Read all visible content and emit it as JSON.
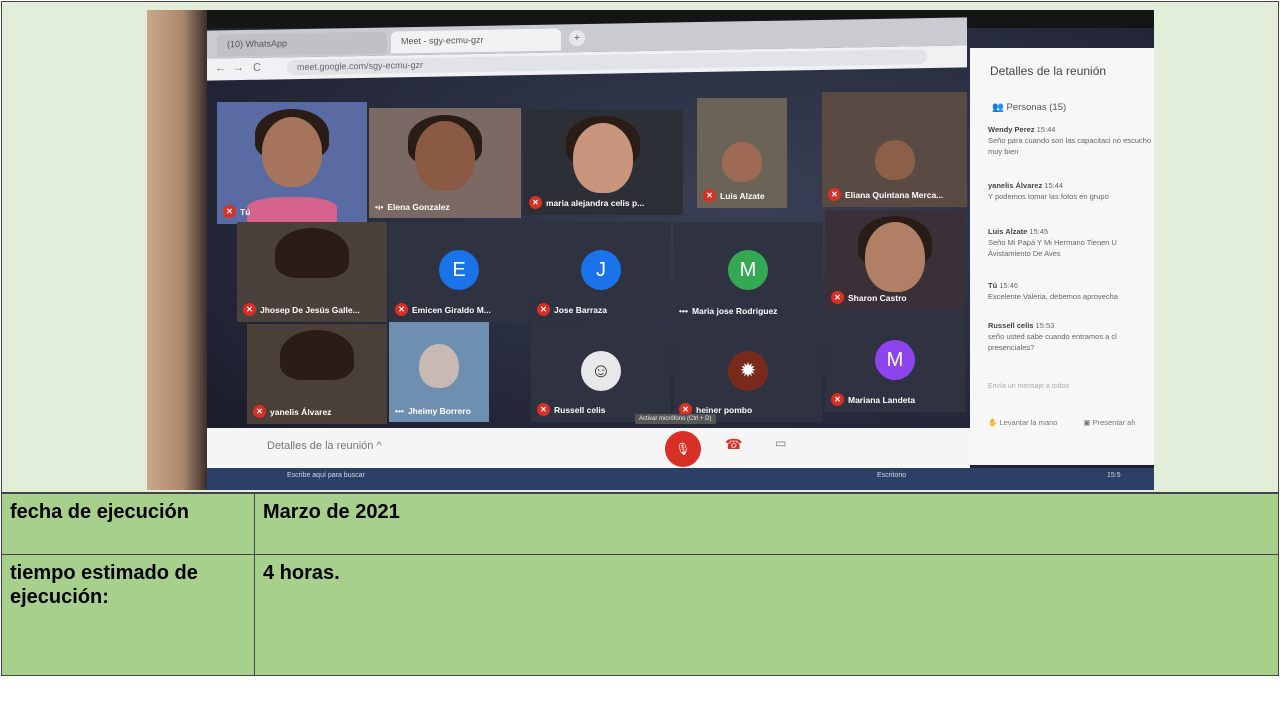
{
  "browser": {
    "tab1_label": "(10) WhatsApp",
    "tab2_label": "Meet - sgy-ecmu-gzr",
    "new_tab": "+",
    "url": "meet.google.com/sgy-ecmu-gzr"
  },
  "participants": [
    {
      "name": "Tú",
      "type": "video"
    },
    {
      "name": "Elena Gonzalez",
      "type": "video"
    },
    {
      "name": "maria alejandra celis p...",
      "type": "video"
    },
    {
      "name": "Luis Alzate",
      "type": "video"
    },
    {
      "name": "Eliana Quintana Merca...",
      "type": "video"
    },
    {
      "name": "Jhosep De Jesús Galle...",
      "type": "video"
    },
    {
      "name": "Emicen Giraldo M...",
      "type": "avatar",
      "initial": "E",
      "color": "#1a73e8"
    },
    {
      "name": "Jose Barraza",
      "type": "avatar",
      "initial": "J",
      "color": "#1a73e8"
    },
    {
      "name": "Maria jose Rodriguez",
      "type": "avatar",
      "initial": "M",
      "color": "#34a853"
    },
    {
      "name": "Sharon Castro",
      "type": "video"
    },
    {
      "name": "yanelis Álvarez",
      "type": "video"
    },
    {
      "name": "Jheimy Borrero",
      "type": "video"
    },
    {
      "name": "Russell celis",
      "type": "image"
    },
    {
      "name": "heiner pombo",
      "type": "image"
    },
    {
      "name": "Mariana Landeta",
      "type": "avatar",
      "initial": "M",
      "color": "#8e44ec"
    }
  ],
  "panel": {
    "title": "Detalles de la reunión",
    "people": "Personas (15)",
    "messages": [
      {
        "sender": "Wendy Perez",
        "time": "15:44",
        "text": "Seño para cuando son las capacitaci no escucho muy bien"
      },
      {
        "sender": "yanelis Álvarez",
        "time": "15:44",
        "text": "Y podemos tomar las fotos en grupo"
      },
      {
        "sender": "Luis Alzate",
        "time": "15:45",
        "text": "Seño Mi Papá Y Mi Hermano Tienen U Avistamiento De Aves"
      },
      {
        "sender": "Tú",
        "time": "15:46",
        "text": "Excelente Valeria, debemos aprovecha"
      },
      {
        "sender": "Russell celis",
        "time": "15:53",
        "text": "seño usted sabe cuando entramos a cl presenciales?"
      }
    ],
    "input_placeholder": "Envía un mensaje a todos",
    "raise_hand": "Levantar la mano",
    "present": "Presentar ah"
  },
  "bottom_bar": {
    "details_label": "Detalles de la reunión ^",
    "tooltip": "Activar micrófono (Ctrl + D)"
  },
  "taskbar": {
    "search": "Escribe aquí para buscar",
    "desktop": "Escritorio",
    "time": "15:5"
  },
  "table": [
    {
      "label": "fecha de ejecución",
      "value": "Marzo de 2021"
    },
    {
      "label": "tiempo estimado de ejecución:",
      "value": "4 horas."
    }
  ]
}
